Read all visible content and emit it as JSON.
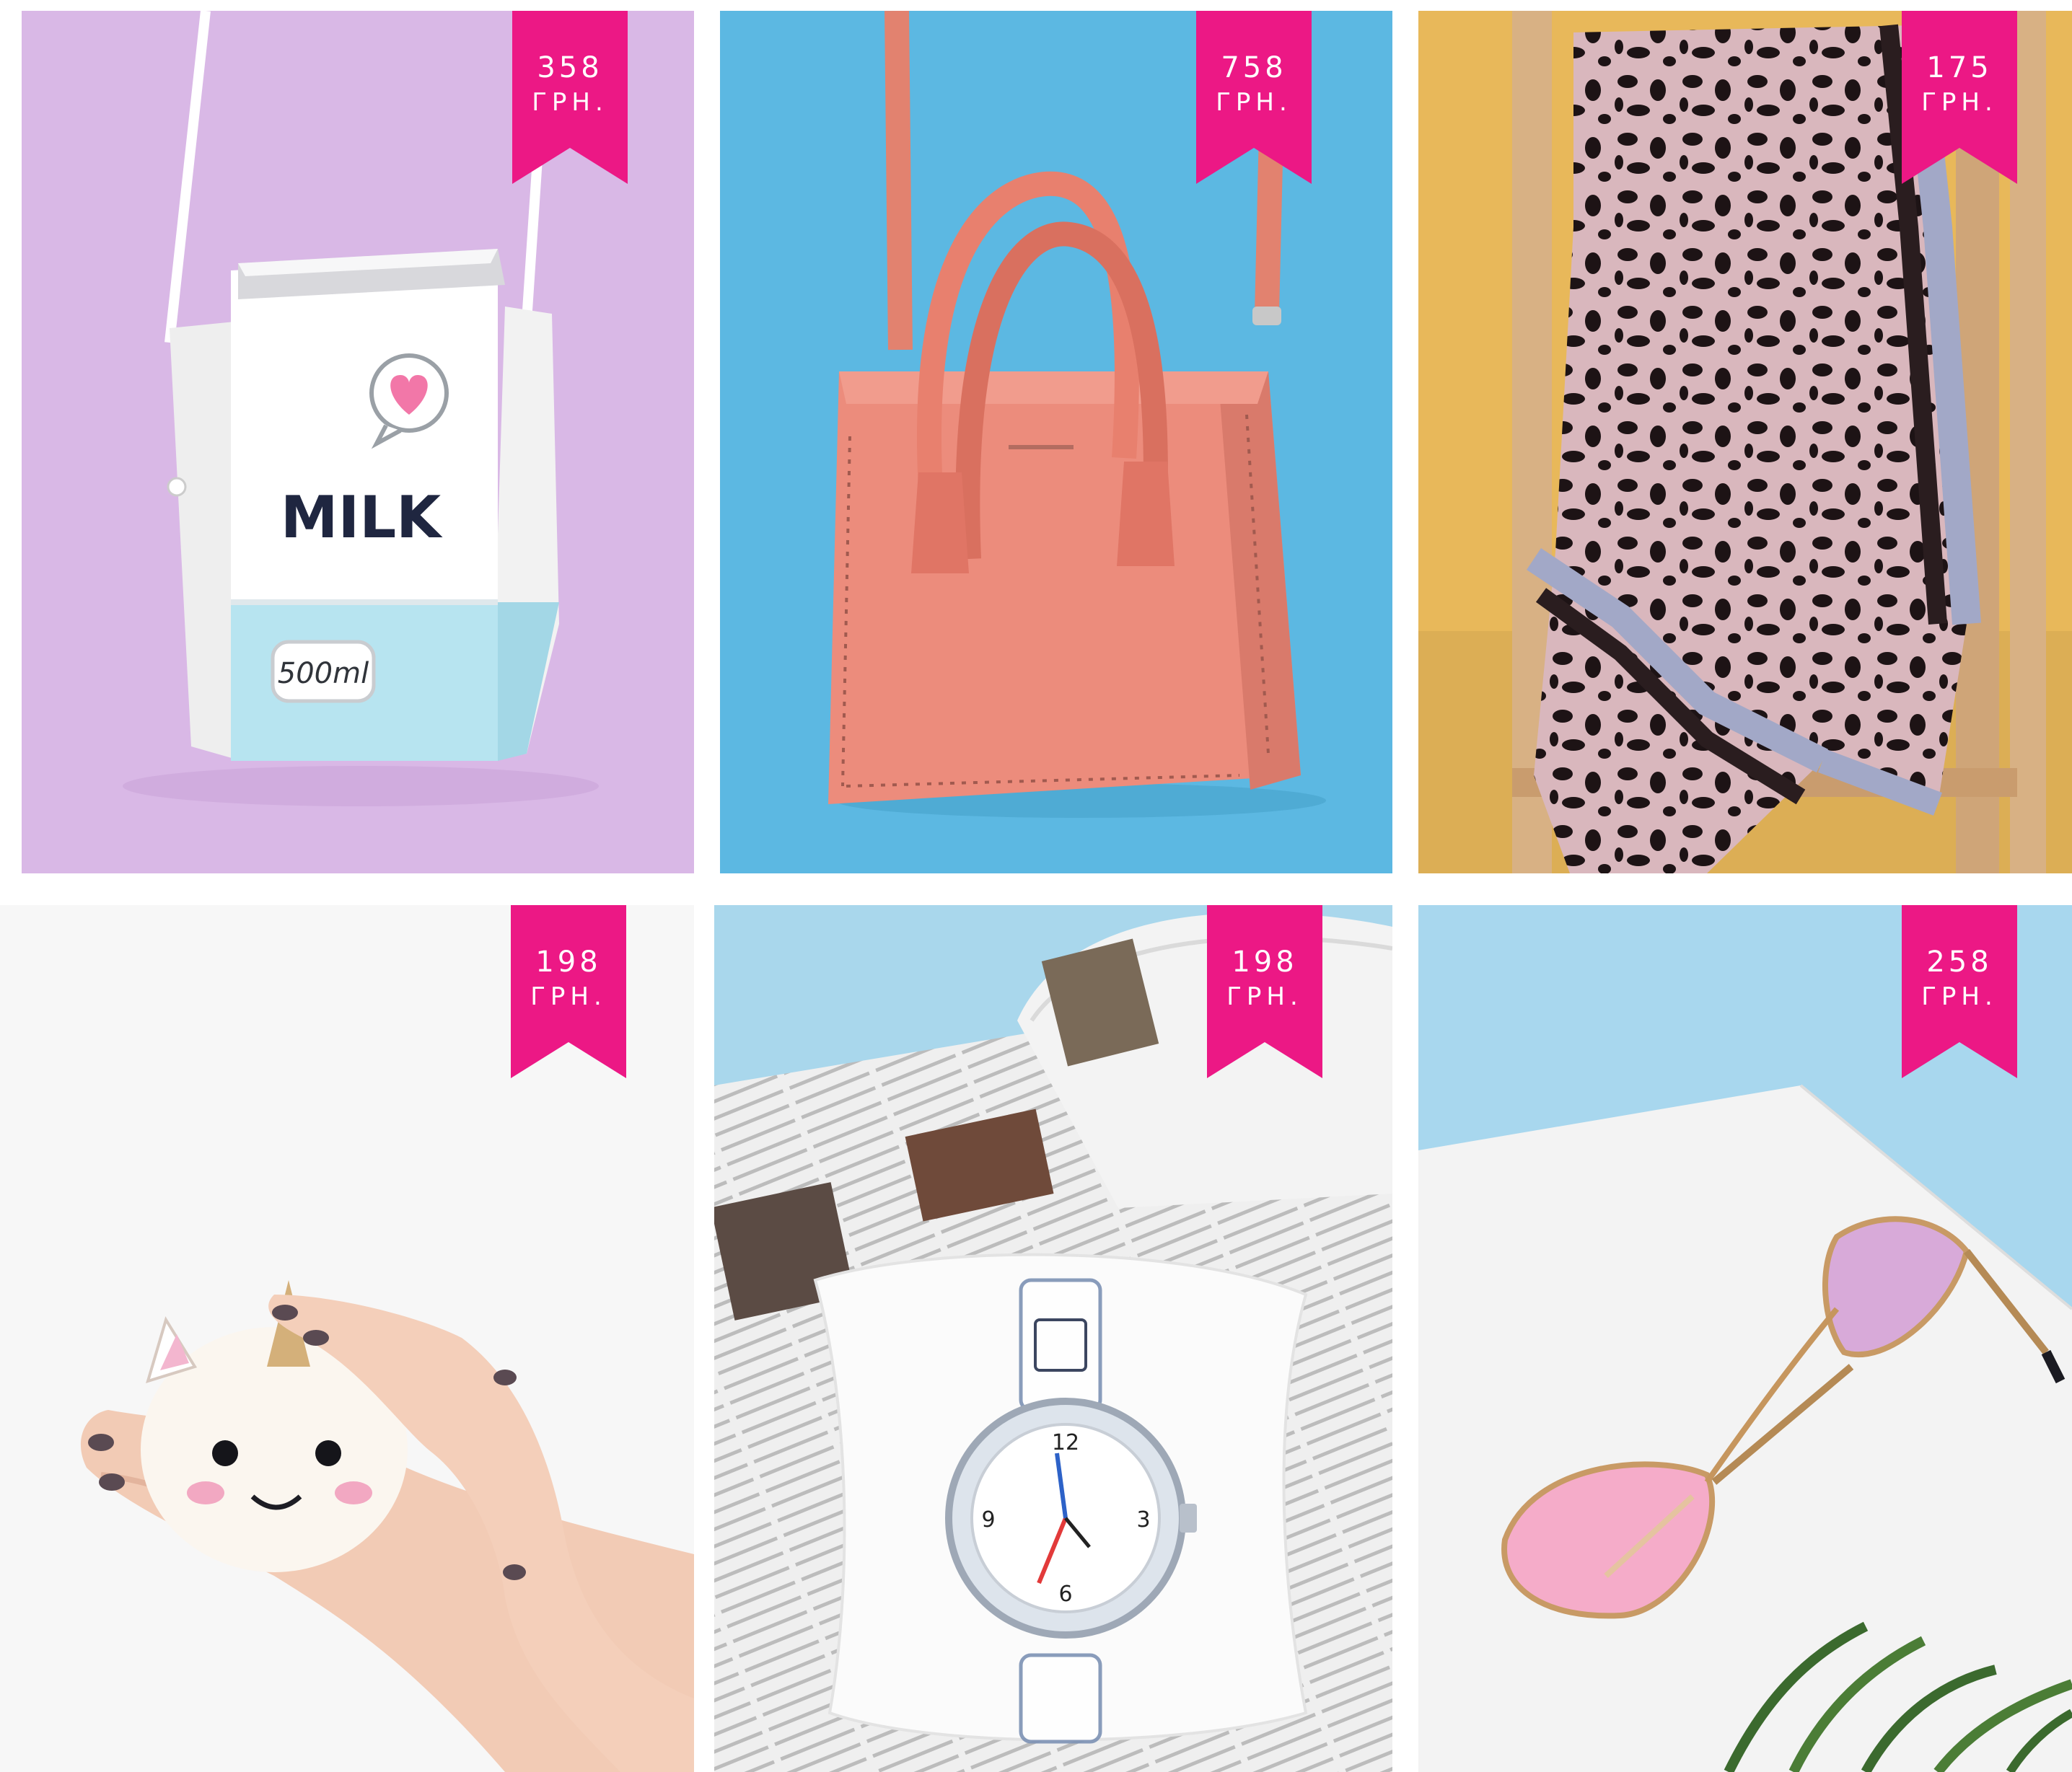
{
  "colors": {
    "ribbon": "#ec1885",
    "lavender_bg": "#d7b4e4",
    "blue_bg": "#5db9e2",
    "mustard_bg": "#e9b95a",
    "white_bg": "#f6f6f6"
  },
  "products": [
    {
      "id": "milk-bag",
      "price": "358",
      "currency": "ГРН.",
      "print": {
        "main": "MILK",
        "volume": "500ml"
      }
    },
    {
      "id": "coral-handbag",
      "price": "758",
      "currency": "ГРН."
    },
    {
      "id": "leopard-scarf",
      "price": "175",
      "currency": "ГРН."
    },
    {
      "id": "unicorn-mug",
      "price": "198",
      "currency": "ГРН."
    },
    {
      "id": "clear-watch",
      "price": "198",
      "currency": "ГРН."
    },
    {
      "id": "pink-sunglasses",
      "price": "258",
      "currency": "ГРН."
    }
  ]
}
